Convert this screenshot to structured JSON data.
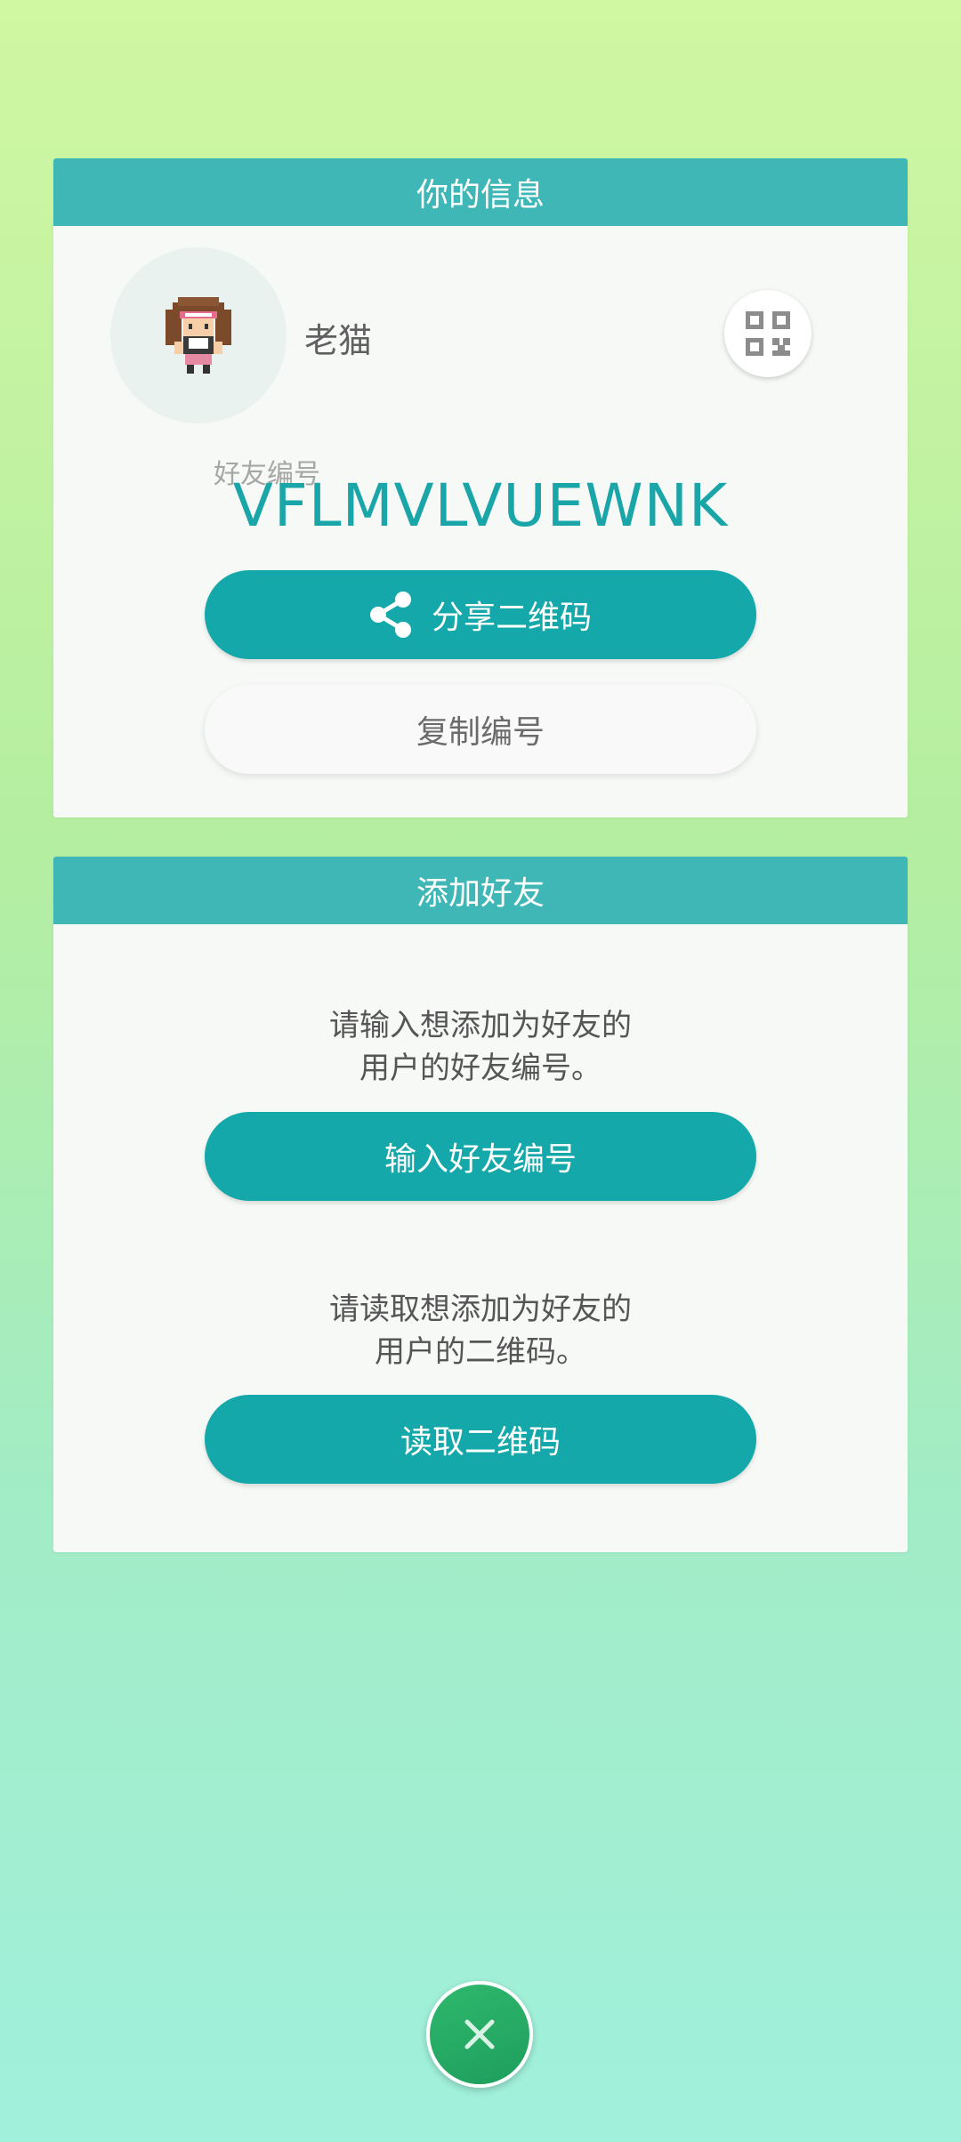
{
  "profile_card": {
    "title": "你的信息",
    "username": "老猫",
    "friend_code_label": "好友编号",
    "friend_code": "VFLMVLVUEWNK",
    "share_label": "分享二维码",
    "copy_label": "复制编号",
    "icons": [
      "trainer-avatar-icon",
      "qr-code-icon",
      "share-icon"
    ]
  },
  "add_card": {
    "title": "添加好友",
    "enter_instruction_line1": "请输入想添加为好友的",
    "enter_instruction_line2": "用户的好友编号。",
    "enter_label": "输入好友编号",
    "scan_instruction_line1": "请读取想添加为好友的",
    "scan_instruction_line2": "用户的二维码。",
    "scan_label": "读取二维码"
  },
  "footer": {
    "close_icon": "close-icon"
  },
  "colors": {
    "header": "#3fb7b6",
    "primary": "#15a8aa",
    "friend_code_text": "#1aa6a8",
    "close_button": "#24a866"
  }
}
